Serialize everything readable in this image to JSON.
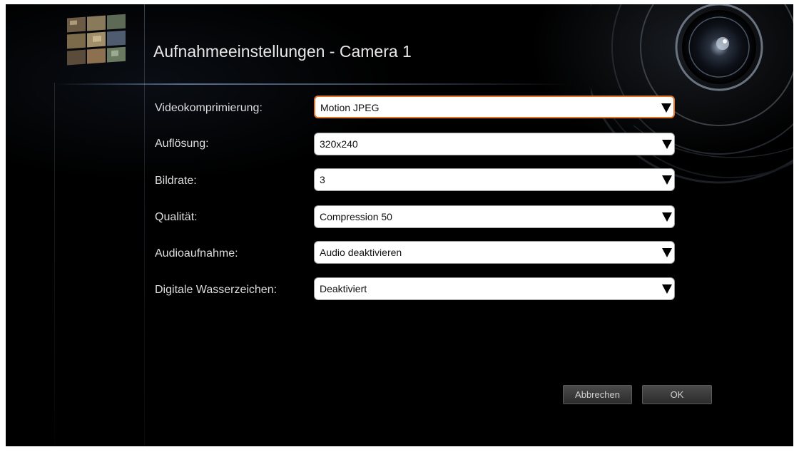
{
  "title": "Aufnahmeeinstellungen - Camera 1",
  "settings": [
    {
      "label": "Videokomprimierung:",
      "value": "Motion JPEG"
    },
    {
      "label": "Auflösung:",
      "value": "320x240"
    },
    {
      "label": "Bildrate:",
      "value": "3"
    },
    {
      "label": "Qualität:",
      "value": "Compression 50"
    },
    {
      "label": "Audioaufnahme:",
      "value": "Audio deaktivieren"
    },
    {
      "label": "Digitale Wasserzeichen:",
      "value": "Deaktiviert"
    }
  ],
  "buttons": {
    "cancel": "Abbrechen",
    "ok": "OK"
  },
  "colors": {
    "background": "#000000",
    "focus_border": "#e0762c",
    "text": "#dedede"
  },
  "icons": [
    "camera-lens-decoration",
    "surveillance-thumbnail-icon",
    "dropdown-arrow-icon"
  ]
}
